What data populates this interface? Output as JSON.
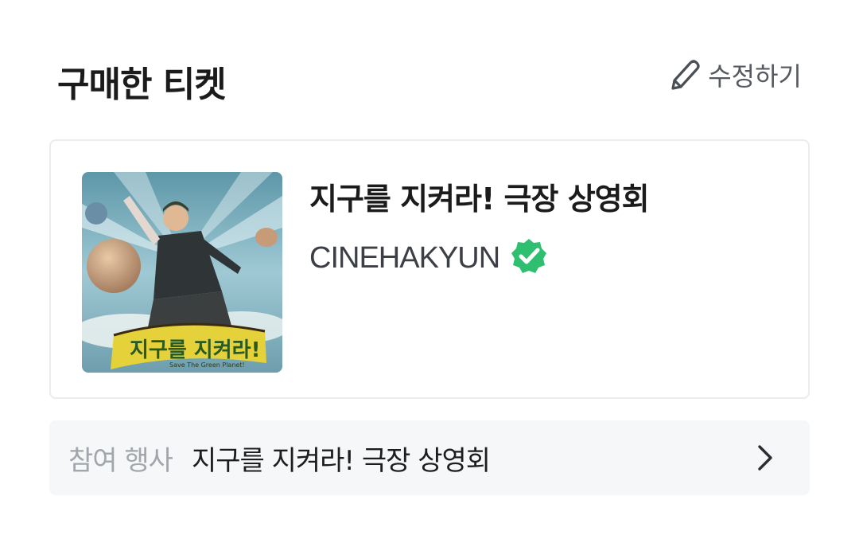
{
  "section": {
    "title": "구매한 티켓",
    "edit_label": "수정하기"
  },
  "ticket": {
    "title": "지구를 지켜라! 극장 상영회",
    "organizer": "CINEHAKYUN",
    "verified_icon": "verified-check-icon",
    "poster_text": "지구를 지켜라!",
    "poster_subtitle": "Save The Green Planet!"
  },
  "event": {
    "label": "참여 행사",
    "name": "지구를 지켜라! 극장 상영회"
  },
  "colors": {
    "verified": "#2fbf71",
    "event_row_bg": "#f6f7f9",
    "card_border": "#ececee"
  }
}
